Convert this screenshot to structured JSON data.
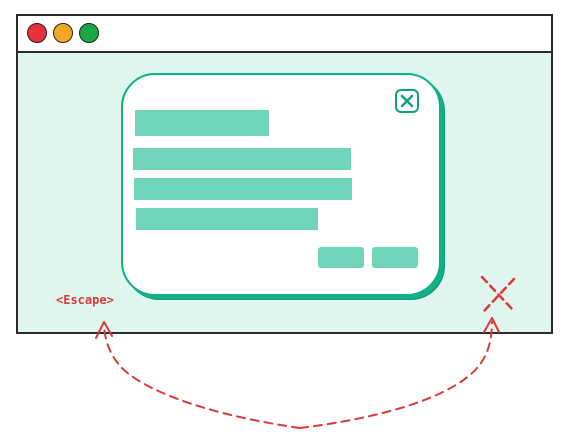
{
  "window": {
    "traffic_lights": [
      "red",
      "yellow",
      "green"
    ]
  },
  "dialog": {
    "close_icon": "close-x-icon",
    "text_lines": 4,
    "action_buttons": 2
  },
  "annotations": {
    "escape_label": "<Escape>",
    "outside_click_icon": "dashed-x-icon"
  },
  "colors": {
    "accent": "#11b088",
    "placeholder": "#70d5bb",
    "backdrop": "#dff5ee",
    "annotation": "#d93a3a"
  }
}
